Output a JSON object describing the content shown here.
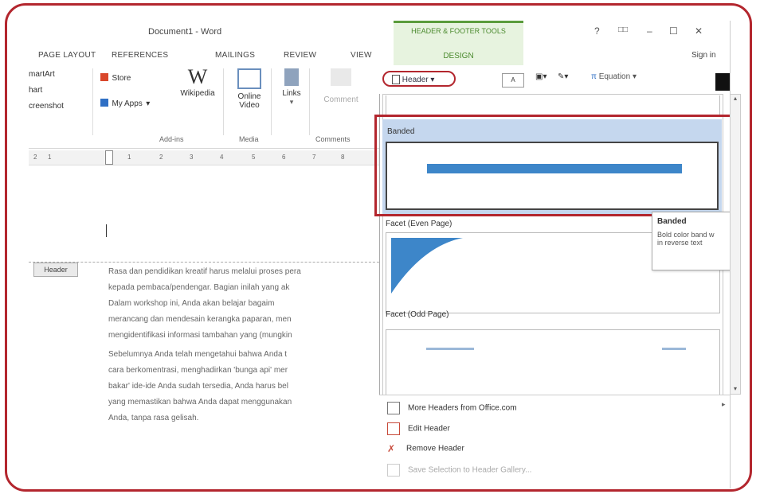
{
  "window": {
    "title": "Document1 - Word",
    "context_group": "HEADER & FOOTER TOOLS",
    "context_tab": "DESIGN",
    "controls": [
      "?",
      "□□",
      "–",
      "☐",
      "✕"
    ],
    "sign_in": "Sign in"
  },
  "tabs": [
    "PAGE LAYOUT",
    "REFERENCES",
    "MAILINGS",
    "REVIEW",
    "VIEW"
  ],
  "ribbon": {
    "partial_left": [
      "martArt",
      "hart",
      "creenshot"
    ],
    "store": "Store",
    "my_apps": "My Apps",
    "wikipedia": "Wikipedia",
    "online_video": [
      "Online",
      "Video"
    ],
    "links": "Links",
    "comment": "Comment",
    "groups": [
      "Add-ins",
      "Media",
      "Comments"
    ]
  },
  "design_ribbon": {
    "header_button": "Header",
    "equation": "Equation"
  },
  "ruler": {
    "marks": [
      "2",
      "1",
      "1",
      "2",
      "3",
      "4",
      "5",
      "6",
      "7",
      "8"
    ]
  },
  "document": {
    "header_tag": "Header",
    "paragraph1": [
      "Rasa dan pendidikan kreatif harus melalui proses pera",
      "kepada pembaca/pendengar. Bagian inilah yang ak",
      "Dalam workshop ini, Anda akan belajar bagaim",
      "merancang dan mendesain kerangka paparan, men",
      "mengidentifikasi informasi tambahan yang (mungkin"
    ],
    "paragraph2": [
      "Sebelumnya Anda telah mengetahui bahwa Anda t",
      "cara berkomentrasi, menghadirkan 'bunga api' mer",
      "bakar' ide-ide Anda sudah tersedia, Anda harus bel",
      "yang memastikan bahwa Anda dapat menggunakan",
      "Anda, tanpa rasa gelisah."
    ]
  },
  "gallery": {
    "banded_label": "Banded",
    "facet_even_label": "Facet (Even Page)",
    "facet_odd_label": "Facet (Odd Page)"
  },
  "tooltip": {
    "title": "Banded",
    "text": [
      "Bold color band w",
      "in reverse text"
    ]
  },
  "menu": {
    "more": "More Headers from Office.com",
    "edit": "Edit Header",
    "remove": "Remove Header",
    "save": "Save Selection to Header Gallery..."
  },
  "colors": {
    "highlight_red": "#b3262e",
    "context_green": "#4b8a2e",
    "band_blue": "#3d86c9",
    "selection_blue": "#c5d7ee"
  }
}
